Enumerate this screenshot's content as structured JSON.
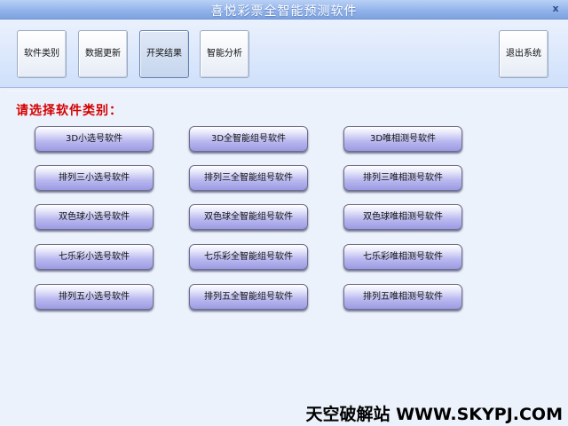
{
  "window": {
    "title": "喜悦彩票全智能预测软件",
    "close_glyph": "x"
  },
  "toolbar": {
    "items": [
      {
        "label": "软件类别"
      },
      {
        "label": "数据更新"
      },
      {
        "label": "开奖结果"
      },
      {
        "label": "智能分析"
      },
      {
        "label": "退出系统"
      }
    ]
  },
  "main": {
    "heading": "请选择软件类别：",
    "columns": [
      [
        "3D小选号软件",
        "排列三小选号软件",
        "双色球小选号软件",
        "七乐彩小选号软件",
        "排列五小选号软件"
      ],
      [
        "3D全智能组号软件",
        "排列三全智能组号软件",
        "双色球全智能组号软件",
        "七乐彩全智能组号软件",
        "排列五全智能组号软件"
      ],
      [
        "3D唯相测号软件",
        "排列三唯相测号软件",
        "双色球唯相测号软件",
        "七乐彩唯相测号软件",
        "排列五唯相测号软件"
      ]
    ]
  },
  "watermark": "天空破解站 WWW.SKYPJ.COM"
}
